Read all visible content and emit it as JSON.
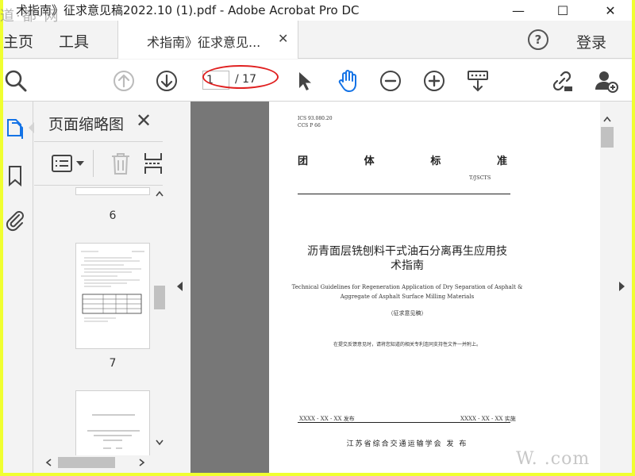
{
  "window": {
    "title": "术指南》征求意见稿2022.10 (1).pdf - Adobe Acrobat Pro DC",
    "minimize": "—",
    "maximize": "☐",
    "close": "✕"
  },
  "watermark": {
    "top_left": "道·都·网",
    "bottom_right": "W.     .com"
  },
  "menu": {
    "home": "主页",
    "tools": "工具",
    "doc_tab": "术指南》征求意见...",
    "doc_tab_close": "✕",
    "help": "?",
    "login": "登录"
  },
  "toolbar": {
    "page_current": "1",
    "page_total": "/ 17",
    "icons": [
      "zoom-icon",
      "page-up-icon",
      "page-down-icon",
      "select-cursor-icon",
      "hand-tool-icon",
      "zoom-out-icon",
      "zoom-in-icon",
      "scroll-mode-icon",
      "share-link-icon",
      "add-user-icon"
    ],
    "accent": "#1473e6",
    "annotation_color": "#e02020"
  },
  "panel": {
    "title": "页面缩略图",
    "close": "✕",
    "thumbnails": [
      {
        "number": "6"
      },
      {
        "number": "7"
      },
      {
        "number": ""
      }
    ]
  },
  "document": {
    "ics": "ICS 93.080.20",
    "ccs": "CCS P 66",
    "standard_type": [
      "团",
      "体",
      "标",
      "准"
    ],
    "standard_code": "T/JSCTS",
    "title_line1": "沥青面层铣刨料干式油石分离再生应用技",
    "title_line2": "术指南",
    "en_line1": "Technical Guidelines for Regeneration Application of Dry Separation of Asphalt &",
    "en_line2": "Aggregate of Asphalt Surface Milling Materials",
    "consultation": "（征求意见稿）",
    "note": "在提交反馈意见时，请将您知道的相关专利连同支持性文件一并附上。",
    "publish_date": "XXXX - XX - XX 发布",
    "implement_date": "XXXX - XX - XX 实施",
    "issuer": "江苏省综合交通运输学会    发 布"
  }
}
